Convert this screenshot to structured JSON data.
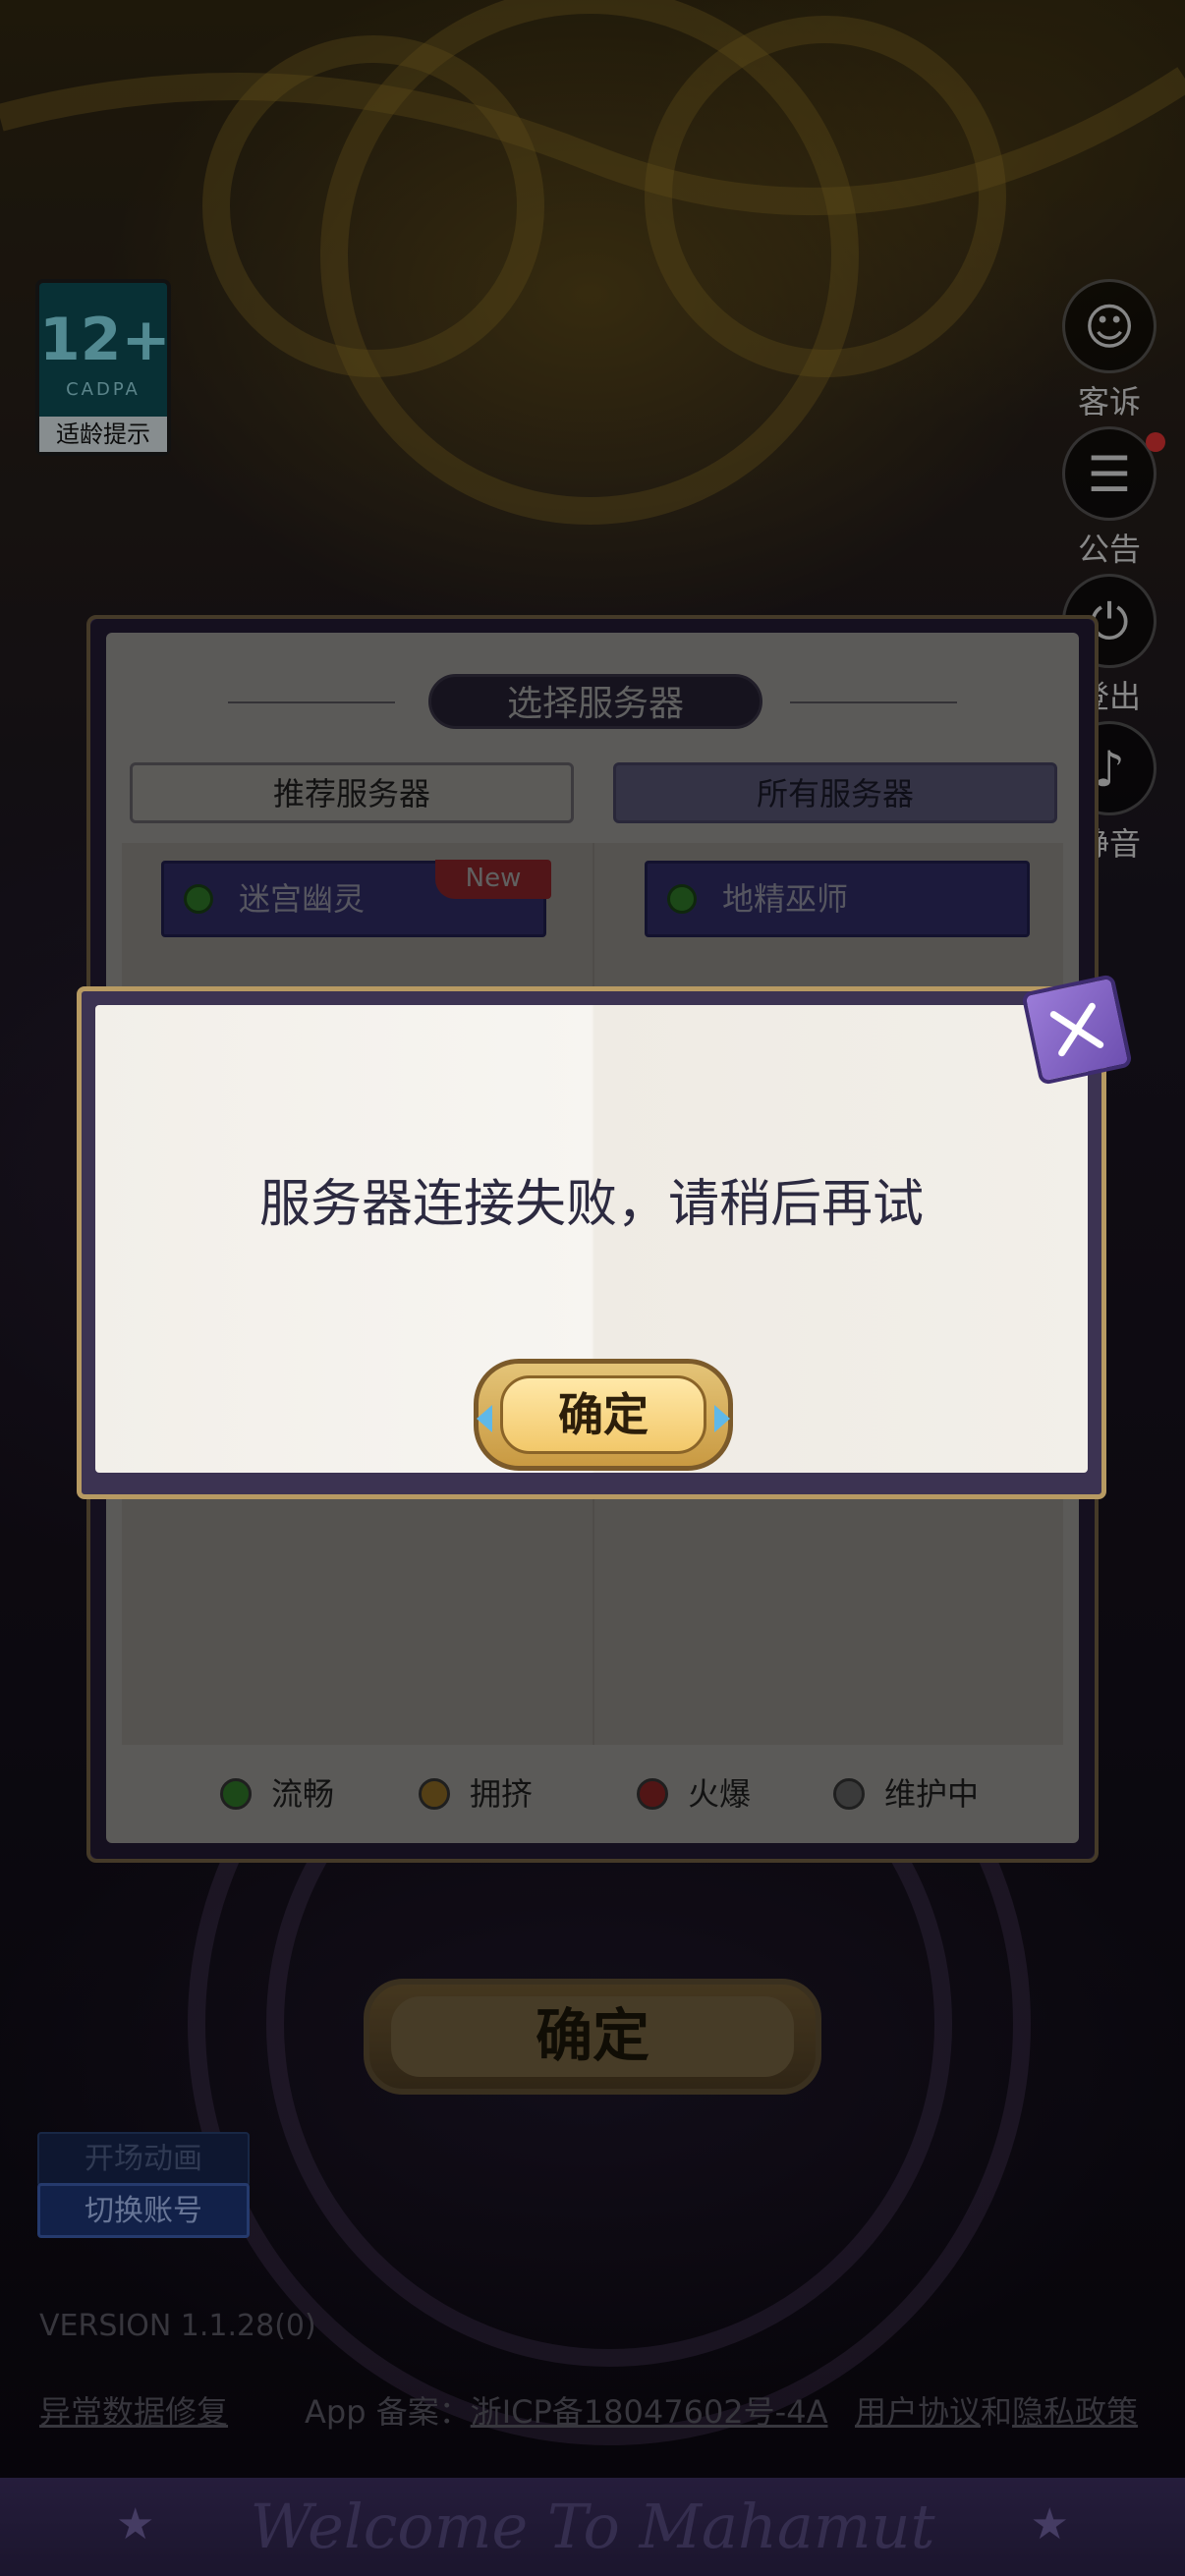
{
  "age_rating": {
    "number": "12+",
    "org": "CADPA",
    "tip": "适龄提示"
  },
  "side_buttons": [
    {
      "label": "客诉",
      "icon": "headset-icon"
    },
    {
      "label": "公告",
      "icon": "notice-icon"
    },
    {
      "label": "登出",
      "icon": "power-icon"
    },
    {
      "label": "静音",
      "icon": "speaker-icon"
    }
  ],
  "server_panel": {
    "title": "选择服务器",
    "tabs": [
      "推荐服务器",
      "所有服务器"
    ],
    "servers": [
      {
        "name": "迷宫幽灵",
        "tag": "New",
        "status": "流畅"
      },
      {
        "name": "地精巫师",
        "status": "流畅"
      }
    ],
    "legend": [
      {
        "label": "流畅",
        "color": "#4cc040"
      },
      {
        "label": "拥挤",
        "color": "#e0a83a"
      },
      {
        "label": "火爆",
        "color": "#d83a3a"
      },
      {
        "label": "维护中",
        "color": "#9a9a9a"
      }
    ]
  },
  "confirm_label": "确定",
  "intro_button": "开场动画",
  "switch_account_button": "切换账号",
  "version": "VERSION 1.1.28(0)",
  "footer": {
    "data_repair": "异常数据修复",
    "icp_prefix": "App 备案：",
    "icp_link": "浙ICP备18047602号-4A",
    "agreement": "用户协议",
    "and": "和",
    "privacy": "隐私政策"
  },
  "bottom_banner": "Welcome To Mahamut",
  "dialog": {
    "message": "服务器连接失败，请稍后再试",
    "ok_label": "确定"
  }
}
